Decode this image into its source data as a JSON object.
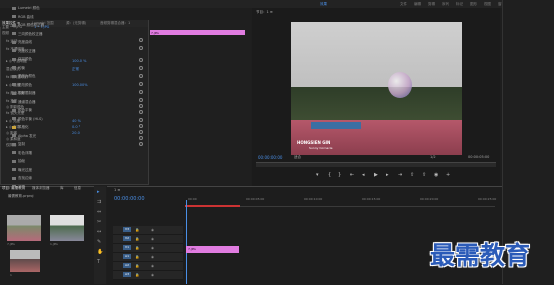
{
  "top_menu": [
    "文件",
    "编辑",
    "剪辑",
    "序列",
    "标记",
    "图形",
    "视图",
    "窗口",
    "帮助"
  ],
  "top_menu_active": "效果",
  "effect_controls": {
    "tabs": [
      "效果控件 ≡",
      "Lumetri 范围",
      "源：(无剪辑)",
      "音频剪辑混合器：1"
    ],
    "header_source": "主要 * 7.JPG",
    "header_clip": "1 * 7.JPG",
    "section_video": "视频",
    "rows": [
      {
        "label": "fx 运动",
        "value": ""
      },
      {
        "label": "fx 不透明度",
        "value": ""
      },
      {
        "label": "▸ ◎ 不透明度",
        "value": "100.0 %"
      },
      {
        "label": "混合模式",
        "value": "正常"
      },
      {
        "label": "fx 时间重映射",
        "value": ""
      },
      {
        "label": "▸ ◎ 速度",
        "value": "100.00%"
      },
      {
        "label": "fx 颜色平衡",
        "value": ""
      },
      {
        "label": "fx 投影",
        "value": ""
      },
      {
        "label": "◎ 阴影颜色",
        "value": ""
      },
      {
        "label": "fx 镜头光晕",
        "value": ""
      },
      {
        "label": "▸ ◎ 亮度",
        "value": "40 %"
      },
      {
        "label": "▸ ◎ 方向",
        "value": "0.0 °"
      },
      {
        "label": "◎ 距离",
        "value": "20.0"
      },
      {
        "label": "◎ 柔和度",
        "value": ""
      },
      {
        "label": "仅阴影",
        "value": ""
      }
    ],
    "clip_label": "7.JPG"
  },
  "program_monitor": {
    "title": "节目：1 ≡",
    "timecode": "00:00:00:00",
    "fit": "适合",
    "quality": "1/2",
    "duration": "00:00:05:00",
    "watermark": "HONGSIEN GIN",
    "watermark_sub": "Sunny Cornacle"
  },
  "effects_list": [
    "Lumetri 颜色",
    "RGB 曲线",
    "RGB 颜色校正器",
    "三向颜色校正器",
    "亮度曲线",
    "亮度校正器",
    "保留颜色",
    "均衡",
    "更改为颜色",
    "更改颜色",
    "视频限制器",
    "通道混合器",
    "颜色平衡",
    "颜色平衡 (HLS)",
    "风格化",
    "Alpha 发光",
    "复制",
    "彩色浮雕",
    "抽帧",
    "曝光过度",
    "查找边缘",
    "浮雕",
    "画笔描边",
    "粗糙边缘",
    "纹理化",
    "色调分离",
    "闪光灯",
    "阈值",
    "马赛克",
    "视频过渡",
    "效果预设"
  ],
  "project": {
    "tabs": [
      "项目: 最需教育",
      "媒体浏览器",
      "库",
      "信息"
    ],
    "bin_name": "最需教育.prproj",
    "thumbs": [
      "7.JPG",
      "1.JPG",
      "1"
    ]
  },
  "timeline": {
    "title": "1 ≡",
    "timecode": "00:00:00:00",
    "ticks": [
      "00:00",
      "00:00:05:00",
      "00:00:10:00",
      "00:00:15:00",
      "00:00:20:00",
      "00:00:25:00"
    ],
    "tracks": [
      "V3",
      "V2",
      "V1",
      "A1",
      "A2",
      "A3"
    ],
    "clip_label": "7.JPG"
  },
  "brand": "最需教育"
}
